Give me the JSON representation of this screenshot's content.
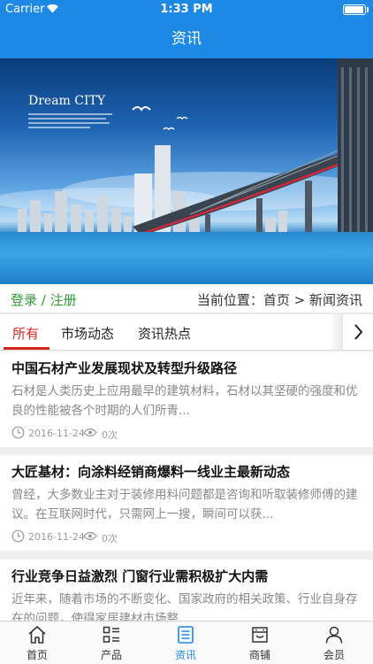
{
  "status_bar": {
    "carrier": "Carrier",
    "time": "1:33 PM"
  },
  "nav": {
    "title": "资讯"
  },
  "banner": {
    "brand": "Dream CITY"
  },
  "login_row": {
    "login_text": "登录 / 注册",
    "breadcrumb": "当前位置：首页 > 新闻资讯"
  },
  "tabs": [
    {
      "label": "所有",
      "active": true
    },
    {
      "label": "市场动态",
      "active": false
    },
    {
      "label": "资讯热点",
      "active": false
    }
  ],
  "articles": [
    {
      "title": "中国石材产业发展现状及转型升级路径",
      "summary": "  石材是人类历史上应用最早的建筑材料，石材以其坚硬的强度和优良的性能被各个时期的人们所青...",
      "date": "2016-11-24",
      "views": "0次"
    },
    {
      "title": "大匠基材：向涂料经销商爆料一线业主最新动态",
      "summary": "曾经，大多数业主对于装修用料问题都是咨询和听取装修师傅的建议。在互联网时代，只需网上一搜，瞬间可以获...",
      "date": "2016-11-24",
      "views": "0次"
    },
    {
      "title": "行业竞争日益激烈 门窗行业需积极扩大内需",
      "summary": "  近年来，随着市场的不断变化、国家政府的相关政策、行业自身存在的问题，使得家居建材市场整...",
      "date": "",
      "views": ""
    }
  ],
  "tabbar": [
    {
      "label": "首页",
      "icon": "home-icon",
      "active": false
    },
    {
      "label": "产品",
      "icon": "list-icon",
      "active": false
    },
    {
      "label": "资讯",
      "icon": "document-icon",
      "active": true
    },
    {
      "label": "商铺",
      "icon": "store-icon",
      "active": false
    },
    {
      "label": "会员",
      "icon": "user-icon",
      "active": false
    }
  ],
  "colors": {
    "primary": "#1e88e5",
    "login_green": "#2e9d38",
    "tab_active": "#d8261d"
  }
}
